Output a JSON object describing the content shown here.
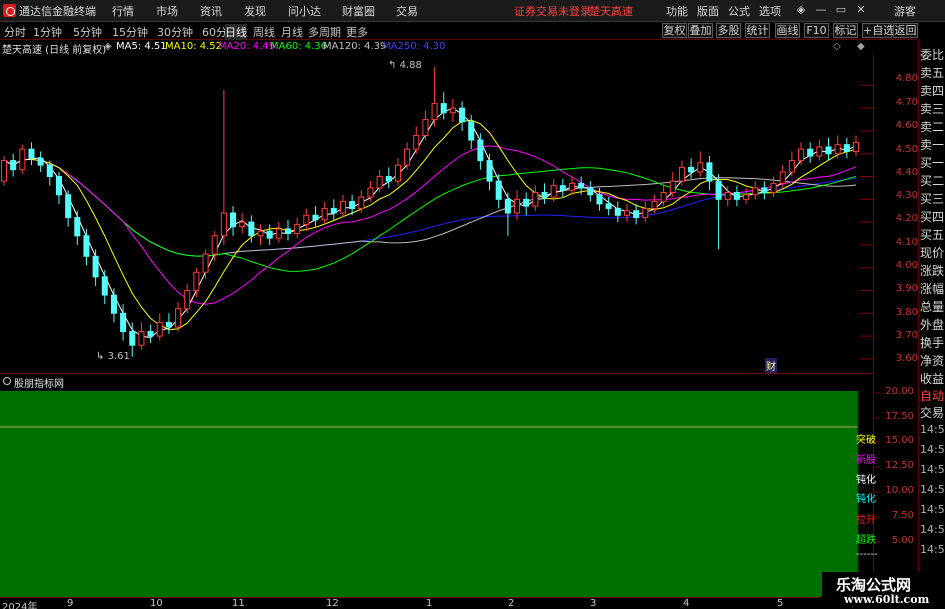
{
  "menubar": {
    "app_title": "通达信金融终端",
    "menus": [
      "行情",
      "市场",
      "资讯",
      "发现",
      "问小达",
      "财富圈",
      "交易"
    ],
    "notice": "证券交易未登录",
    "stock_name": "楚天高速",
    "right_menus": [
      "功能",
      "版面",
      "公式",
      "选项"
    ],
    "user": "游客"
  },
  "periods": [
    "分时",
    "1分钟",
    "5分钟",
    "15分钟",
    "30分钟",
    "60分钟",
    "日线",
    "周线",
    "月线",
    "多周期",
    "更多"
  ],
  "active_period": "日线",
  "tools": [
    "复权",
    "叠加",
    "多股",
    "统计",
    "画线",
    "F10",
    "标记",
    "+自选",
    "返回"
  ],
  "chart_header": {
    "title": "楚天高速 (日线 前复权)",
    "ma5": "MA5: 4.51",
    "ma10": "MA10: 4.52",
    "ma20": "MA20: 4.49",
    "ma60": "MA60: 4.36",
    "ma120": "MA120: 4.39",
    "ma250": "MA250: 4.30"
  },
  "colors": {
    "up": "#ff3c3c",
    "down": "#54fcfc",
    "ma5": "#ffffff",
    "ma10": "#ffff00",
    "ma20": "#ff00ff",
    "ma60": "#00ff00",
    "ma120": "#c0c0c0",
    "ma250": "#2020ff",
    "indicator_fill": "#007000"
  },
  "annotations": {
    "high": "4.88",
    "low": "3.61",
    "fin_marker": "财"
  },
  "price_ticks": [
    "4.80",
    "4.70",
    "4.60",
    "4.50",
    "4.40",
    "4.30",
    "4.20",
    "4.10",
    "4.00",
    "3.90",
    "3.80",
    "3.70",
    "3.60"
  ],
  "indicator": {
    "title": "股朋指标网",
    "ticks": [
      "20.00",
      "17.50",
      "15.00",
      "12.50",
      "10.00",
      "7.50",
      "5.00"
    ],
    "signals": [
      {
        "label": "突破",
        "color": "#ffff00"
      },
      {
        "label": "新股",
        "color": "#ff00ff"
      },
      {
        "label": "钝化",
        "color": "#ffffff"
      },
      {
        "label": "钝化",
        "color": "#00ffff"
      },
      {
        "label": "拉升",
        "color": "#ff2020"
      },
      {
        "label": "超跌",
        "color": "#00ff00"
      }
    ]
  },
  "dates": [
    "2024年",
    "9",
    "10",
    "11",
    "12",
    "1",
    "2",
    "3",
    "4",
    "5"
  ],
  "right_panel": {
    "labels": [
      "委比",
      "卖五",
      "卖四",
      "卖三",
      "卖二",
      "卖一",
      "买一",
      "买二",
      "买三",
      "买四",
      "买五",
      "现价",
      "涨跌",
      "涨幅",
      "总量",
      "外盘",
      "换手",
      "净资",
      "收益"
    ],
    "mode": "自动",
    "trade": "交易",
    "times": [
      "14:56",
      "14:56",
      "14:56",
      "14:56",
      "14:56",
      "14:56",
      "14:56"
    ]
  },
  "watermark": {
    "title": "乐淘公式网",
    "url": "www.60lt.com"
  },
  "chart_data": {
    "type": "candlestick",
    "y_range": [
      3.56,
      4.92
    ],
    "candles": [
      [
        4.38,
        4.47,
        4.49,
        4.36
      ],
      [
        4.47,
        4.43,
        4.5,
        4.4
      ],
      [
        4.43,
        4.52,
        4.54,
        4.41
      ],
      [
        4.52,
        4.48,
        4.55,
        4.45
      ],
      [
        4.48,
        4.45,
        4.51,
        4.42
      ],
      [
        4.45,
        4.4,
        4.47,
        4.36
      ],
      [
        4.4,
        4.32,
        4.42,
        4.28
      ],
      [
        4.32,
        4.22,
        4.34,
        4.18
      ],
      [
        4.22,
        4.14,
        4.25,
        4.1
      ],
      [
        4.14,
        4.05,
        4.17,
        4.01
      ],
      [
        4.05,
        3.96,
        4.08,
        3.92
      ],
      [
        3.96,
        3.88,
        3.99,
        3.84
      ],
      [
        3.88,
        3.8,
        3.91,
        3.76
      ],
      [
        3.8,
        3.72,
        3.84,
        3.68
      ],
      [
        3.72,
        3.66,
        3.76,
        3.61
      ],
      [
        3.66,
        3.72,
        3.76,
        3.64
      ],
      [
        3.72,
        3.7,
        3.75,
        3.67
      ],
      [
        3.7,
        3.76,
        3.8,
        3.68
      ],
      [
        3.76,
        3.74,
        3.8,
        3.71
      ],
      [
        3.74,
        3.82,
        3.85,
        3.72
      ],
      [
        3.82,
        3.9,
        3.93,
        3.8
      ],
      [
        3.9,
        3.98,
        4.0,
        3.87
      ],
      [
        3.98,
        4.06,
        4.08,
        3.95
      ],
      [
        4.06,
        4.14,
        4.16,
        4.03
      ],
      [
        4.14,
        4.24,
        4.78,
        4.1
      ],
      [
        4.24,
        4.18,
        4.27,
        4.14
      ],
      [
        4.18,
        4.2,
        4.24,
        4.15
      ],
      [
        4.2,
        4.14,
        4.23,
        4.11
      ],
      [
        4.14,
        4.16,
        4.19,
        4.1
      ],
      [
        4.16,
        4.13,
        4.19,
        4.1
      ],
      [
        4.13,
        4.17,
        4.2,
        4.11
      ],
      [
        4.17,
        4.15,
        4.21,
        4.12
      ],
      [
        4.15,
        4.19,
        4.22,
        4.13
      ],
      [
        4.19,
        4.23,
        4.26,
        4.16
      ],
      [
        4.23,
        4.21,
        4.27,
        4.18
      ],
      [
        4.21,
        4.26,
        4.29,
        4.19
      ],
      [
        4.26,
        4.24,
        4.3,
        4.21
      ],
      [
        4.24,
        4.29,
        4.32,
        4.22
      ],
      [
        4.29,
        4.26,
        4.32,
        4.23
      ],
      [
        4.26,
        4.31,
        4.34,
        4.24
      ],
      [
        4.31,
        4.35,
        4.38,
        4.29
      ],
      [
        4.35,
        4.4,
        4.43,
        4.33
      ],
      [
        4.4,
        4.38,
        4.44,
        4.35
      ],
      [
        4.38,
        4.45,
        4.48,
        4.36
      ],
      [
        4.45,
        4.52,
        4.55,
        4.43
      ],
      [
        4.52,
        4.58,
        4.62,
        4.5
      ],
      [
        4.58,
        4.65,
        4.69,
        4.56
      ],
      [
        4.65,
        4.72,
        4.88,
        4.62
      ],
      [
        4.72,
        4.68,
        4.77,
        4.65
      ],
      [
        4.68,
        4.7,
        4.74,
        4.64
      ],
      [
        4.7,
        4.64,
        4.73,
        4.6
      ],
      [
        4.64,
        4.56,
        4.67,
        4.52
      ],
      [
        4.56,
        4.47,
        4.59,
        4.43
      ],
      [
        4.47,
        4.38,
        4.5,
        4.34
      ],
      [
        4.38,
        4.3,
        4.41,
        4.26
      ],
      [
        4.3,
        4.24,
        4.33,
        4.14
      ],
      [
        4.24,
        4.3,
        4.34,
        4.21
      ],
      [
        4.3,
        4.27,
        4.33,
        4.23
      ],
      [
        4.27,
        4.33,
        4.36,
        4.25
      ],
      [
        4.33,
        4.31,
        4.37,
        4.28
      ],
      [
        4.31,
        4.36,
        4.39,
        4.29
      ],
      [
        4.36,
        4.34,
        4.39,
        4.31
      ],
      [
        4.34,
        4.37,
        4.4,
        4.32
      ],
      [
        4.37,
        4.35,
        4.4,
        4.32
      ],
      [
        4.35,
        4.32,
        4.38,
        4.29
      ],
      [
        4.32,
        4.28,
        4.35,
        4.25
      ],
      [
        4.28,
        4.26,
        4.31,
        4.23
      ],
      [
        4.26,
        4.23,
        4.29,
        4.2
      ],
      [
        4.23,
        4.25,
        4.28,
        4.2
      ],
      [
        4.25,
        4.22,
        4.28,
        4.19
      ],
      [
        4.22,
        4.26,
        4.29,
        4.2
      ],
      [
        4.26,
        4.29,
        4.32,
        4.24
      ],
      [
        4.29,
        4.33,
        4.36,
        4.27
      ],
      [
        4.33,
        4.38,
        4.42,
        4.31
      ],
      [
        4.38,
        4.44,
        4.47,
        4.36
      ],
      [
        4.44,
        4.42,
        4.48,
        4.39
      ],
      [
        4.42,
        4.46,
        4.51,
        4.4
      ],
      [
        4.46,
        4.38,
        4.49,
        4.34
      ],
      [
        4.38,
        4.3,
        4.41,
        4.08
      ],
      [
        4.3,
        4.33,
        4.36,
        4.27
      ],
      [
        4.33,
        4.3,
        4.36,
        4.27
      ],
      [
        4.3,
        4.32,
        4.35,
        4.28
      ],
      [
        4.32,
        4.35,
        4.38,
        4.3
      ],
      [
        4.35,
        4.33,
        4.38,
        4.3
      ],
      [
        4.33,
        4.37,
        4.4,
        4.31
      ],
      [
        4.37,
        4.42,
        4.45,
        4.35
      ],
      [
        4.42,
        4.47,
        4.51,
        4.4
      ],
      [
        4.47,
        4.52,
        4.55,
        4.45
      ],
      [
        4.52,
        4.49,
        4.55,
        4.46
      ],
      [
        4.49,
        4.53,
        4.56,
        4.47
      ],
      [
        4.53,
        4.5,
        4.57,
        4.47
      ],
      [
        4.5,
        4.54,
        4.58,
        4.48
      ],
      [
        4.54,
        4.51,
        4.57,
        4.48
      ],
      [
        4.51,
        4.55,
        4.58,
        4.49
      ]
    ]
  }
}
